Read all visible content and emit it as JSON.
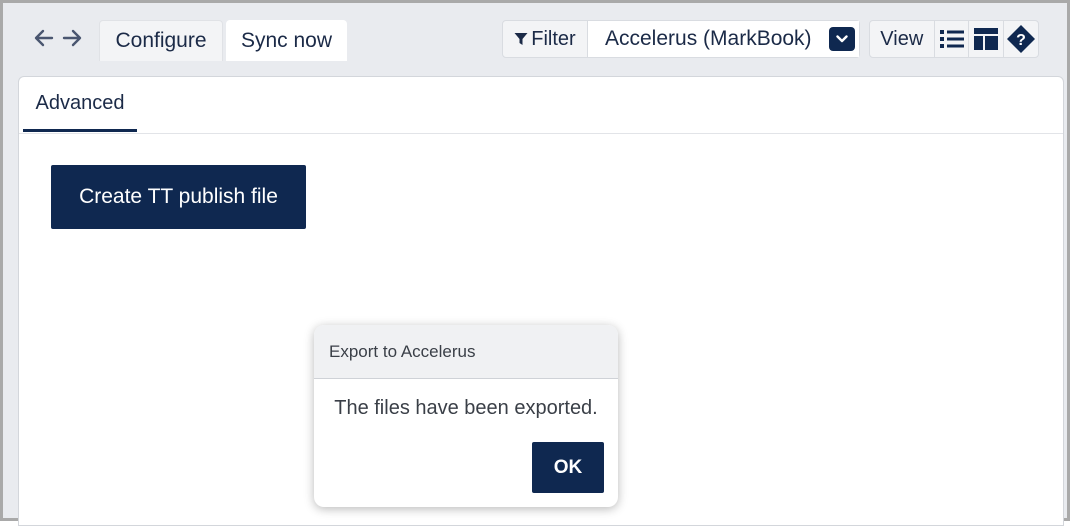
{
  "toolbar": {
    "tabs": [
      {
        "label": "Configure",
        "active": false
      },
      {
        "label": "Sync now",
        "active": true
      }
    ],
    "filter_label": "Filter",
    "filter_value": "Accelerus (MarkBook)",
    "view_label": "View"
  },
  "panel": {
    "subtab_label": "Advanced",
    "create_button_label": "Create TT publish file"
  },
  "dialog": {
    "title": "Export to Accelerus",
    "message": "The files have been exported.",
    "ok_label": "OK"
  },
  "icons": [
    "arrow-left-icon",
    "arrow-right-icon",
    "filter-icon",
    "chevron-down-icon",
    "list-view-icon",
    "layout-view-icon",
    "help-icon"
  ],
  "colors": {
    "accent": "#0f2850",
    "background": "#e9ebef",
    "panel": "#ffffff"
  }
}
